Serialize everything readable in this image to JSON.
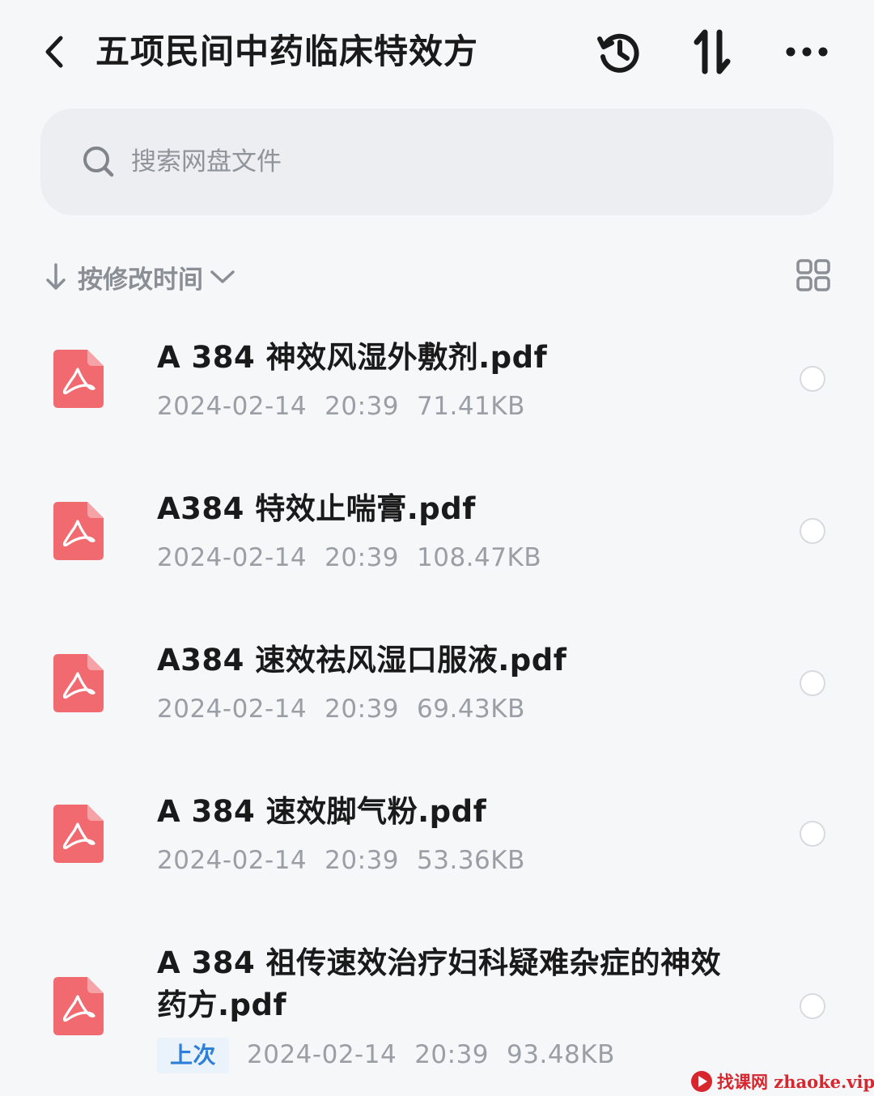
{
  "header": {
    "title": "五项民间中药临床特效方",
    "back_icon": "chevron-left-icon",
    "history_icon": "history-clock-icon",
    "sort_icon": "sort-arrows-icon",
    "more_icon": "more-dots-icon"
  },
  "search": {
    "placeholder": "搜索网盘文件"
  },
  "sort": {
    "label": "按修改时间",
    "view_icon": "grid-view-icon"
  },
  "files": [
    {
      "name": "A 384 神效风湿外敷剂.pdf",
      "date": "2024-02-14",
      "time": "20:39",
      "size": "71.41KB",
      "badge": ""
    },
    {
      "name": "A384  特效止喘膏.pdf",
      "date": "2024-02-14",
      "time": "20:39",
      "size": "108.47KB",
      "badge": ""
    },
    {
      "name": "A384  速效祛风湿口服液.pdf",
      "date": "2024-02-14",
      "time": "20:39",
      "size": "69.43KB",
      "badge": ""
    },
    {
      "name": "A 384 速效脚气粉.pdf",
      "date": "2024-02-14",
      "time": "20:39",
      "size": "53.36KB",
      "badge": ""
    },
    {
      "name": "A 384 祖传速效治疗妇科疑难杂症的神效药方.pdf",
      "date": "2024-02-14",
      "time": "20:39",
      "size": "93.48KB",
      "badge": "上次"
    }
  ],
  "watermark": {
    "text": "找课网 zhaoke.vip"
  },
  "colors": {
    "background": "#f6f7f9",
    "pdf_icon": "#f06a6f",
    "badge_text": "#2f7fd9",
    "watermark": "#d7262e"
  }
}
